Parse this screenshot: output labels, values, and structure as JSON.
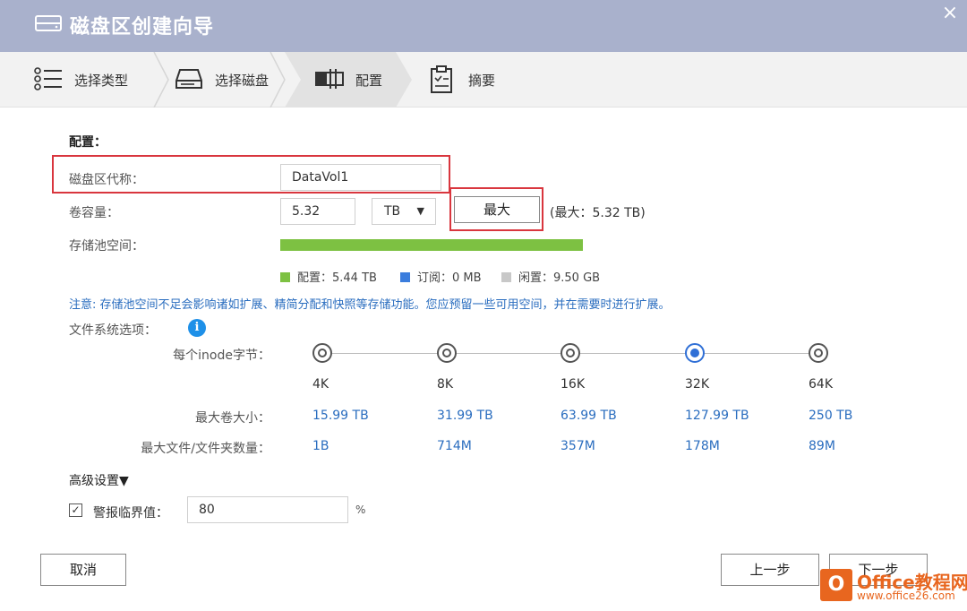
{
  "window": {
    "title": "磁盘区创建向导",
    "close_glyph": "×"
  },
  "steps": [
    {
      "label": "选择类型",
      "icon": "list-icon"
    },
    {
      "label": "选择磁盘",
      "icon": "disk-icon"
    },
    {
      "label": "配置",
      "icon": "volume-config-icon"
    },
    {
      "label": "摘要",
      "icon": "clipboard-icon"
    }
  ],
  "active_step": 2,
  "config": {
    "section_title": "配置：",
    "alias_label": "磁盘区代称：",
    "alias_value": "DataVol1",
    "capacity_label": "卷容量：",
    "capacity_value": "5.32",
    "unit_value": "TB",
    "max_button": "最大",
    "max_hint": "(最大：5.32 TB)",
    "pool_label": "存储池空间：",
    "pool_fill_percent": 100
  },
  "legend": [
    {
      "text": "配置：5.44 TB",
      "color": "#7dc142"
    },
    {
      "text": "订阅：0 MB",
      "color": "#3b7ddd"
    },
    {
      "text": "闲置：9.50 GB",
      "color": "#c8c8c8"
    }
  ],
  "note": "注意: 存储池空间不足会影响诸如扩展、精简分配和快照等存储功能。您应预留一些可用空间，并在需要时进行扩展。",
  "fs": {
    "label": "文件系统选项：",
    "info_glyph": "i",
    "inode_label": "每个inode字节：",
    "max_volume_label": "最大卷大小：",
    "max_files_label": "最大文件/文件夹数量：",
    "options": [
      {
        "size": "4K",
        "max_volume": "15.99 TB",
        "max_files": "1B"
      },
      {
        "size": "8K",
        "max_volume": "31.99 TB",
        "max_files": "714M"
      },
      {
        "size": "16K",
        "max_volume": "63.99 TB",
        "max_files": "357M"
      },
      {
        "size": "32K",
        "max_volume": "127.99 TB",
        "max_files": "178M"
      },
      {
        "size": "64K",
        "max_volume": "250 TB",
        "max_files": "89M"
      }
    ],
    "selected_index": 3
  },
  "advanced": {
    "label": "高级设置▼",
    "alert_checked_glyph": "✓",
    "alert_label": "警报临界值：",
    "alert_value": "80",
    "alert_unit": "%"
  },
  "buttons": {
    "cancel": "取消",
    "prev": "上一步",
    "next": "下一步"
  },
  "watermark": {
    "logo": "O",
    "line1": "Office教程网",
    "line2": "www.office26.com"
  }
}
